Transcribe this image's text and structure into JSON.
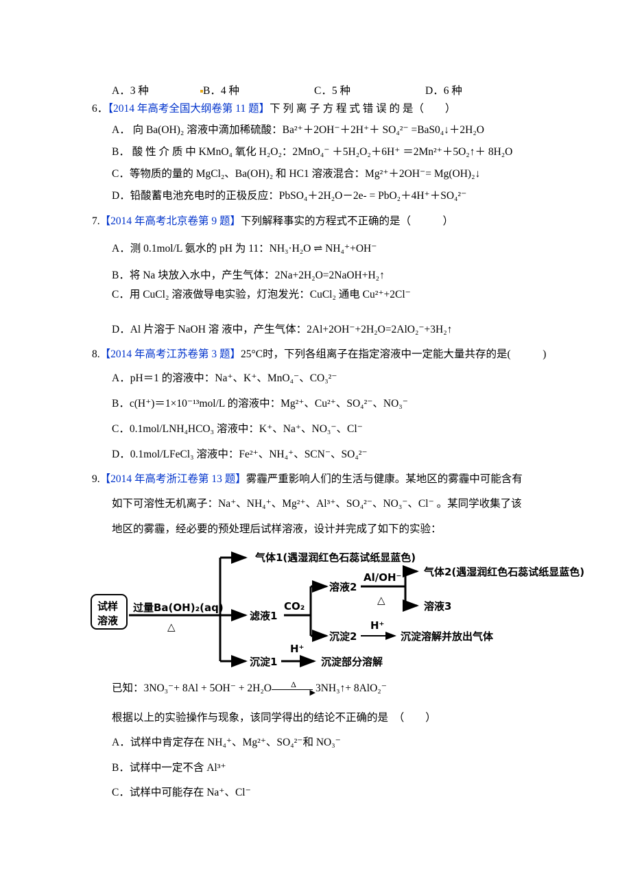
{
  "q5_options": [
    "A．3 种",
    "B．4 种",
    "C．5 种",
    "D．6 种"
  ],
  "q6": {
    "number": "6．",
    "source": "【2014 年高考全国大纲卷第 11 题】",
    "stem": "下 列 离 子 方 程 式 错 误 的 是（　　）",
    "options": {
      "A": {
        "label": "A．",
        "text": "向 Ba(OH)₂ 溶液中滴加稀硫酸：Ba²⁺＋2OH⁻＋2H⁺＋ SO₄²⁻ =BaS0₄↓＋2H₂O"
      },
      "B": {
        "label": "B．",
        "text": "酸 性 介 质 中 KMnO₄ 氧化 H₂O₂：2MnO₄⁻ ＋5H₂O₂＋6H⁺ ＝2Mn²⁺＋5O₂↑＋ 8H₂O"
      },
      "C": {
        "label": "C．",
        "text": "等物质的量的 MgCl₂、Ba(OH)₂ 和 HC1 溶液混合：Mg²⁺＋2OH⁻= Mg(OH)₂↓"
      },
      "D": {
        "label": "D．",
        "text": "铅酸蓄电池充电时的正极反应：PbSO₄＋2H₂O－2e- = PbO₂＋4H⁺＋SO₄²⁻"
      }
    }
  },
  "q7": {
    "number": "7.",
    "source": "【2014 年高考北京卷第 9 题】",
    "stem": "下列解释事实的方程式不正确的是（　　　）",
    "options": {
      "A": {
        "label": "A．",
        "text": "测 0.1mol/L 氨水的 pH 为 11：NH₃·H₂O ⇌ NH₄⁺+OH⁻"
      },
      "B": {
        "label": "B．",
        "text": "将 Na 块放入水中，产生气体：2Na+2H₂O=2NaOH+H₂↑"
      },
      "C": {
        "label": "C．",
        "text": "用 CuCl₂ 溶液做导电实验，灯泡发光：CuCl₂ 通电 Cu²⁺+2Cl⁻",
        "condition": "通电"
      },
      "D": {
        "label": "D．",
        "text": "Al 片溶于 NaOH 溶 液中，产生气体：2Al+2OH⁻+2H₂O=2AlO₂⁻+3H₂↑"
      }
    }
  },
  "q8": {
    "number": "8.",
    "source": "【2014 年高考江苏卷第 3 题】",
    "stem": "25°C时，下列各组离子在指定溶液中一定能大量共存的是(　　　)",
    "options": {
      "A": {
        "label": "A．",
        "text": "pH＝1 的溶液中：Na⁺、K⁺、MnO₄⁻、CO₃²⁻"
      },
      "B": {
        "label": "B．",
        "text": "c(H⁺)＝1×10⁻¹³mol/L 的溶液中：Mg²⁺、Cu²⁺、SO₄²⁻、NO₃⁻"
      },
      "C": {
        "label": "C．",
        "text": "0.1mol/LNH₄HCO₃ 溶液中：K⁺、Na⁺、NO₃⁻、Cl⁻"
      },
      "D": {
        "label": "D．",
        "text": "0.1mol/LFeCl₃ 溶液中：Fe²⁺、NH₄⁺、SCN⁻、SO₄²⁻"
      }
    }
  },
  "q9": {
    "number": "9.",
    "source": "【2014 年高考浙江卷第 13 题】",
    "stem_line1": "雾霾严重影响人们的生活与健康。某地区的雾霾中可能含有",
    "stem_line2": "如下可溶性无机离子：Na⁺、NH₄⁺、Mg²⁺、Al³⁺、SO₄²⁻、NO₃⁻、Cl⁻ 。某同学收集了该",
    "stem_line3": "地区的雾霾，经必要的预处理后试样溶液，设计并完成了如下的实验：",
    "flow": {
      "start_line1": "试样",
      "start_line2": "溶液",
      "reagent1": "过量Ba(OH)₂(aq)",
      "heat": "△",
      "gas1": "气体1(遇湿润红色石蕊试纸显蓝色)",
      "filtrate1": "滤液1",
      "co2": "CO₂",
      "solution2": "溶液2",
      "al_oh": "Al/OH⁻",
      "gas2": "气体2(遇湿润红色石蕊试纸显蓝色)",
      "solution3": "溶液3",
      "precip2": "沉淀2",
      "h_plus": "H⁺",
      "precip2_result": "沉淀溶解并放出气体",
      "precip1": "沉淀1",
      "precip1_result": "沉淀部分溶解"
    },
    "known_label": "已知：",
    "known_lhs": "3NO₃⁻+ 8Al + 5OH⁻ + 2H₂O",
    "known_cond": "Δ",
    "known_rhs": "3NH₃↑+ 8AlO₂⁻",
    "question": "根据以上的实验操作与现象，该同学得出的结论不正确的是　（　　）",
    "options": {
      "A": {
        "label": "A．",
        "text": "试样中肯定存在 NH₄⁺、Mg²⁺、SO₄²⁻和 NO₃⁻"
      },
      "B": {
        "label": "B．",
        "text": "试样中一定不含 Al³⁺"
      },
      "C": {
        "label": "C．",
        "text": "试样中可能存在 Na⁺、Cl⁻"
      }
    }
  }
}
